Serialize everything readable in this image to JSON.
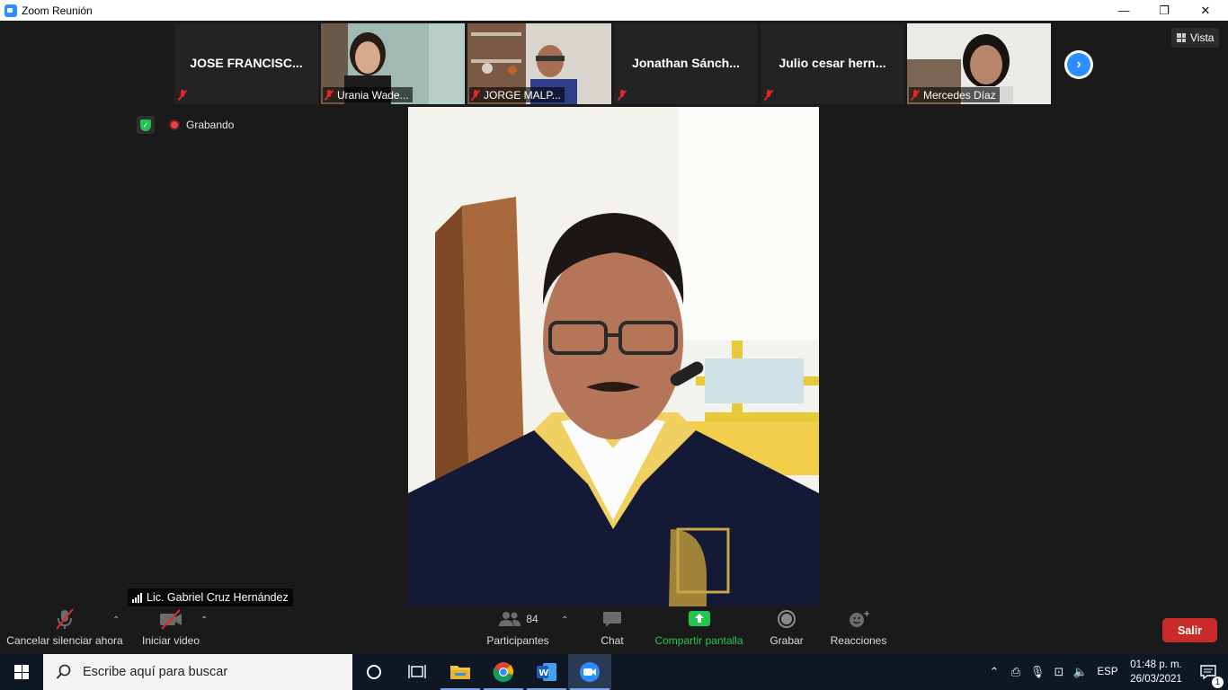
{
  "window": {
    "title": "Zoom Reunión",
    "minimize": "—",
    "restore": "❐",
    "close": "✕"
  },
  "thumbnails": [
    {
      "name": "JOSE  FRANCISC...",
      "label": "",
      "video": false
    },
    {
      "name": "",
      "label": "Urania Wade...",
      "video": true
    },
    {
      "name": "",
      "label": "JORGE MALP...",
      "video": true
    },
    {
      "name": "Jonathan  Sánch...",
      "label": "",
      "video": false
    },
    {
      "name": "Julio cesar hern...",
      "label": "",
      "video": false
    },
    {
      "name": "",
      "label": "Mercedes Díaz",
      "video": true
    }
  ],
  "view_button": {
    "label": "Vista"
  },
  "recording": {
    "label": "Grabando"
  },
  "active_speaker": {
    "name": "Lic. Gabriel Cruz Hernández"
  },
  "toolbar": {
    "unmute": "Cancelar silenciar ahora",
    "start_video": "Iniciar video",
    "participants": "Participantes",
    "participants_count": "84",
    "chat": "Chat",
    "share": "Compartir pantalla",
    "record": "Grabar",
    "reactions": "Reacciones",
    "leave": "Salir"
  },
  "taskbar": {
    "search_placeholder": "Escribe aquí para buscar",
    "language": "ESP",
    "time": "01:48 p. m.",
    "date": "26/03/2021",
    "notifications": "1"
  },
  "colors": {
    "zoom_blue": "#2d8cff",
    "leave_red": "#c92b2b",
    "share_green": "#23c552",
    "muted_red": "#e02828"
  }
}
